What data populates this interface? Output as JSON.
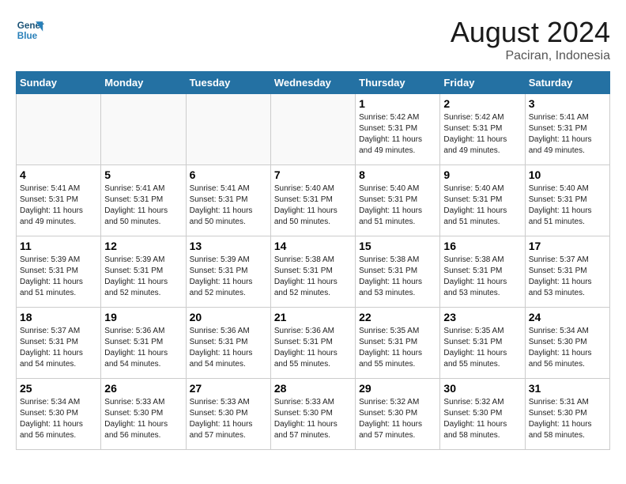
{
  "logo": {
    "line1": "General",
    "line2": "Blue"
  },
  "title": "August 2024",
  "location": "Paciran, Indonesia",
  "days_of_week": [
    "Sunday",
    "Monday",
    "Tuesday",
    "Wednesday",
    "Thursday",
    "Friday",
    "Saturday"
  ],
  "weeks": [
    [
      {
        "day": "",
        "info": ""
      },
      {
        "day": "",
        "info": ""
      },
      {
        "day": "",
        "info": ""
      },
      {
        "day": "",
        "info": ""
      },
      {
        "day": "1",
        "info": "Sunrise: 5:42 AM\nSunset: 5:31 PM\nDaylight: 11 hours and 49 minutes."
      },
      {
        "day": "2",
        "info": "Sunrise: 5:42 AM\nSunset: 5:31 PM\nDaylight: 11 hours and 49 minutes."
      },
      {
        "day": "3",
        "info": "Sunrise: 5:41 AM\nSunset: 5:31 PM\nDaylight: 11 hours and 49 minutes."
      }
    ],
    [
      {
        "day": "4",
        "info": "Sunrise: 5:41 AM\nSunset: 5:31 PM\nDaylight: 11 hours and 49 minutes."
      },
      {
        "day": "5",
        "info": "Sunrise: 5:41 AM\nSunset: 5:31 PM\nDaylight: 11 hours and 50 minutes."
      },
      {
        "day": "6",
        "info": "Sunrise: 5:41 AM\nSunset: 5:31 PM\nDaylight: 11 hours and 50 minutes."
      },
      {
        "day": "7",
        "info": "Sunrise: 5:40 AM\nSunset: 5:31 PM\nDaylight: 11 hours and 50 minutes."
      },
      {
        "day": "8",
        "info": "Sunrise: 5:40 AM\nSunset: 5:31 PM\nDaylight: 11 hours and 51 minutes."
      },
      {
        "day": "9",
        "info": "Sunrise: 5:40 AM\nSunset: 5:31 PM\nDaylight: 11 hours and 51 minutes."
      },
      {
        "day": "10",
        "info": "Sunrise: 5:40 AM\nSunset: 5:31 PM\nDaylight: 11 hours and 51 minutes."
      }
    ],
    [
      {
        "day": "11",
        "info": "Sunrise: 5:39 AM\nSunset: 5:31 PM\nDaylight: 11 hours and 51 minutes."
      },
      {
        "day": "12",
        "info": "Sunrise: 5:39 AM\nSunset: 5:31 PM\nDaylight: 11 hours and 52 minutes."
      },
      {
        "day": "13",
        "info": "Sunrise: 5:39 AM\nSunset: 5:31 PM\nDaylight: 11 hours and 52 minutes."
      },
      {
        "day": "14",
        "info": "Sunrise: 5:38 AM\nSunset: 5:31 PM\nDaylight: 11 hours and 52 minutes."
      },
      {
        "day": "15",
        "info": "Sunrise: 5:38 AM\nSunset: 5:31 PM\nDaylight: 11 hours and 53 minutes."
      },
      {
        "day": "16",
        "info": "Sunrise: 5:38 AM\nSunset: 5:31 PM\nDaylight: 11 hours and 53 minutes."
      },
      {
        "day": "17",
        "info": "Sunrise: 5:37 AM\nSunset: 5:31 PM\nDaylight: 11 hours and 53 minutes."
      }
    ],
    [
      {
        "day": "18",
        "info": "Sunrise: 5:37 AM\nSunset: 5:31 PM\nDaylight: 11 hours and 54 minutes."
      },
      {
        "day": "19",
        "info": "Sunrise: 5:36 AM\nSunset: 5:31 PM\nDaylight: 11 hours and 54 minutes."
      },
      {
        "day": "20",
        "info": "Sunrise: 5:36 AM\nSunset: 5:31 PM\nDaylight: 11 hours and 54 minutes."
      },
      {
        "day": "21",
        "info": "Sunrise: 5:36 AM\nSunset: 5:31 PM\nDaylight: 11 hours and 55 minutes."
      },
      {
        "day": "22",
        "info": "Sunrise: 5:35 AM\nSunset: 5:31 PM\nDaylight: 11 hours and 55 minutes."
      },
      {
        "day": "23",
        "info": "Sunrise: 5:35 AM\nSunset: 5:31 PM\nDaylight: 11 hours and 55 minutes."
      },
      {
        "day": "24",
        "info": "Sunrise: 5:34 AM\nSunset: 5:30 PM\nDaylight: 11 hours and 56 minutes."
      }
    ],
    [
      {
        "day": "25",
        "info": "Sunrise: 5:34 AM\nSunset: 5:30 PM\nDaylight: 11 hours and 56 minutes."
      },
      {
        "day": "26",
        "info": "Sunrise: 5:33 AM\nSunset: 5:30 PM\nDaylight: 11 hours and 56 minutes."
      },
      {
        "day": "27",
        "info": "Sunrise: 5:33 AM\nSunset: 5:30 PM\nDaylight: 11 hours and 57 minutes."
      },
      {
        "day": "28",
        "info": "Sunrise: 5:33 AM\nSunset: 5:30 PM\nDaylight: 11 hours and 57 minutes."
      },
      {
        "day": "29",
        "info": "Sunrise: 5:32 AM\nSunset: 5:30 PM\nDaylight: 11 hours and 57 minutes."
      },
      {
        "day": "30",
        "info": "Sunrise: 5:32 AM\nSunset: 5:30 PM\nDaylight: 11 hours and 58 minutes."
      },
      {
        "day": "31",
        "info": "Sunrise: 5:31 AM\nSunset: 5:30 PM\nDaylight: 11 hours and 58 minutes."
      }
    ]
  ]
}
